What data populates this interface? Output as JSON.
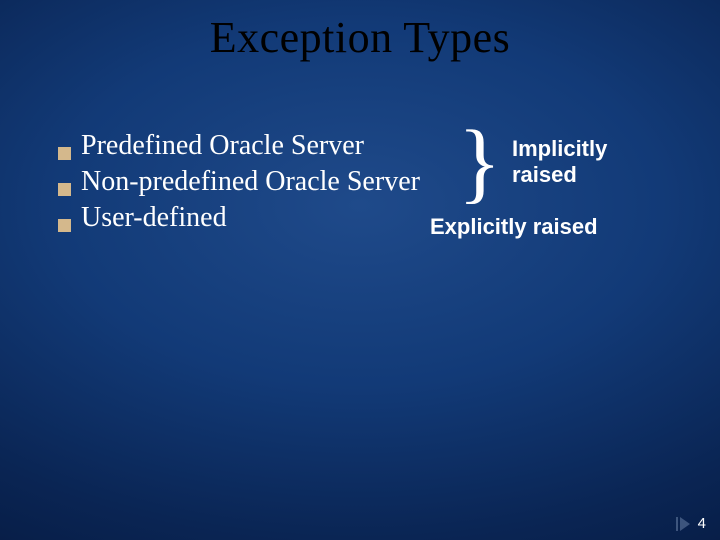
{
  "title": "Exception Types",
  "bullets": [
    "Predefined Oracle Server",
    "Non-predefined Oracle Server",
    "User-defined"
  ],
  "labels": {
    "implicit_line1": "Implicitly",
    "implicit_line2": "raised",
    "explicit": "Explicitly raised",
    "brace": "}"
  },
  "page_number": "4"
}
